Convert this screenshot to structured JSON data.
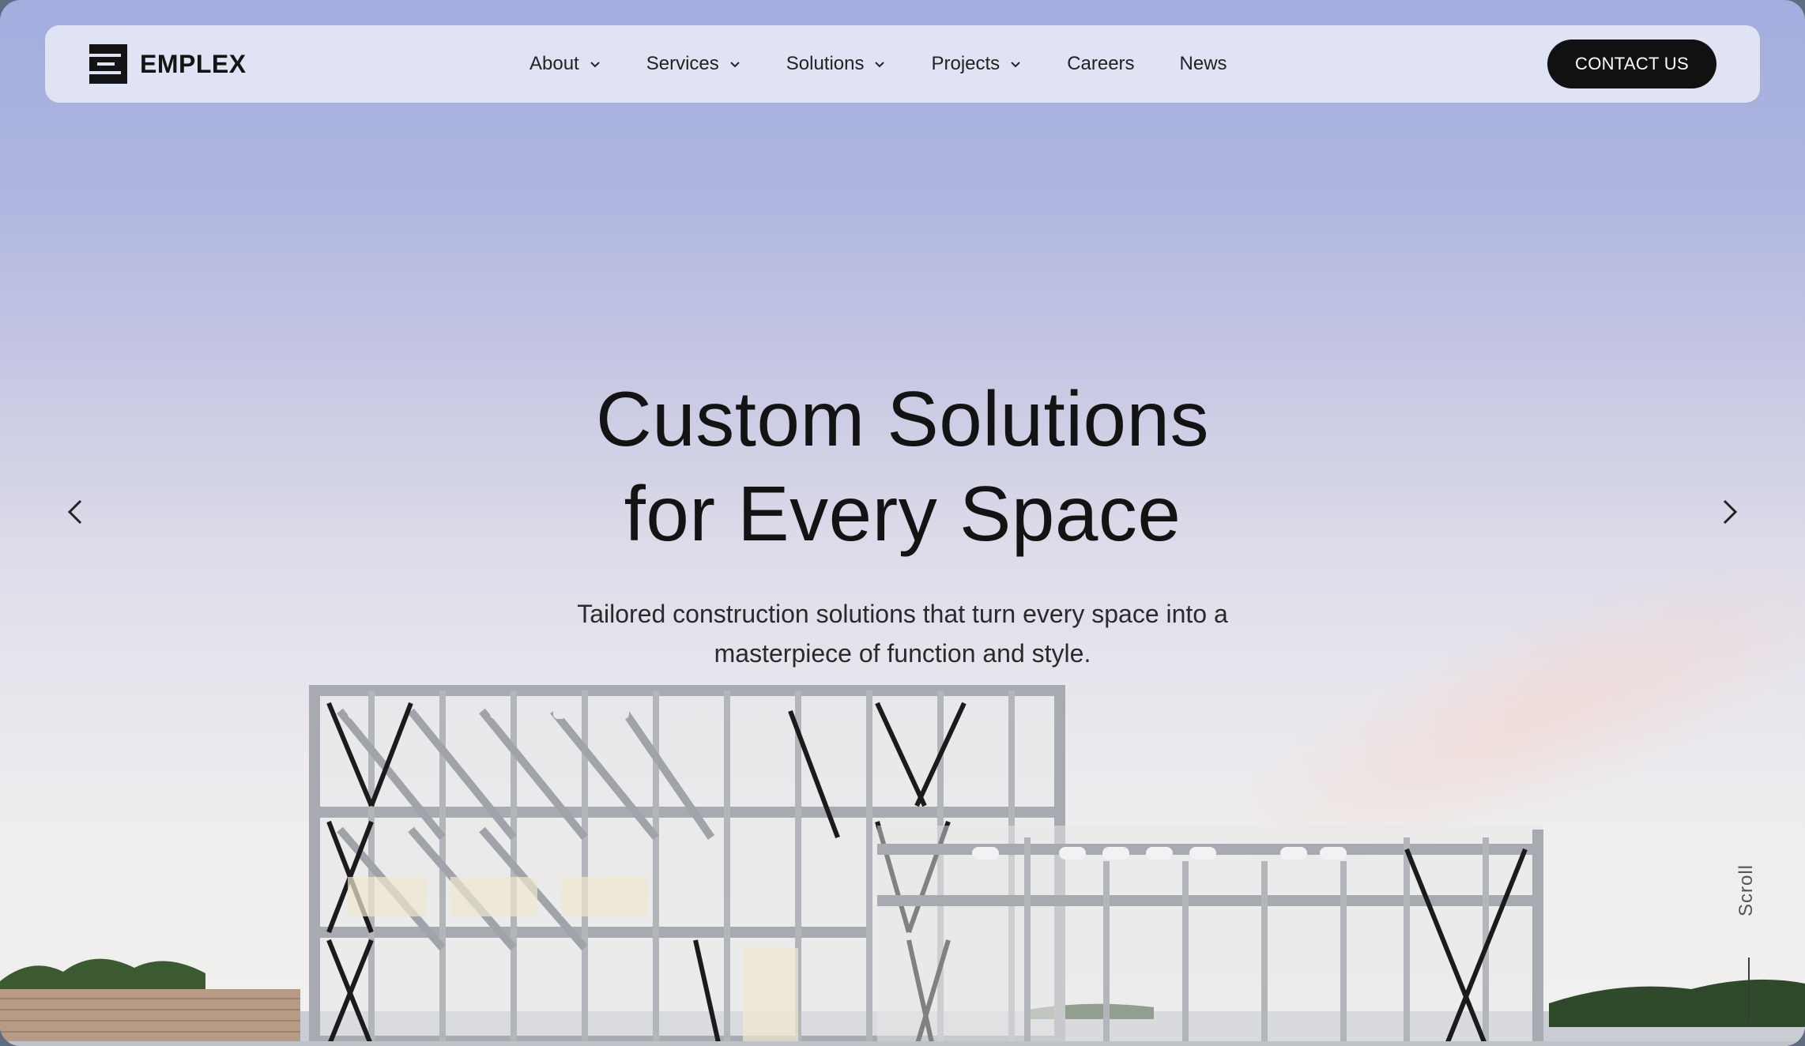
{
  "brand": {
    "name": "EMPLEX",
    "logo_icon": "stacked-bars-logo-icon"
  },
  "nav": {
    "items": [
      {
        "label": "About",
        "has_dropdown": true
      },
      {
        "label": "Services",
        "has_dropdown": true
      },
      {
        "label": "Solutions",
        "has_dropdown": true
      },
      {
        "label": "Projects",
        "has_dropdown": true
      },
      {
        "label": "Careers",
        "has_dropdown": false
      },
      {
        "label": "News",
        "has_dropdown": false
      }
    ],
    "cta_label": "CONTACT US"
  },
  "hero": {
    "title_line1": "Custom Solutions",
    "title_line2": "for Every Space",
    "subtitle_line1": "Tailored construction solutions that turn every space into a",
    "subtitle_line2": "masterpiece of function and style.",
    "prev_icon": "chevron-left-icon",
    "next_icon": "chevron-right-icon",
    "scroll_label": "Scroll"
  },
  "colors": {
    "sky_top": "#a3aedf",
    "sky_bottom": "#f1f0ee",
    "navbar_bg": "#dfe3f4",
    "cta_bg": "#111111",
    "steel": "#a9acb1",
    "brace": "#1b1b1b"
  }
}
